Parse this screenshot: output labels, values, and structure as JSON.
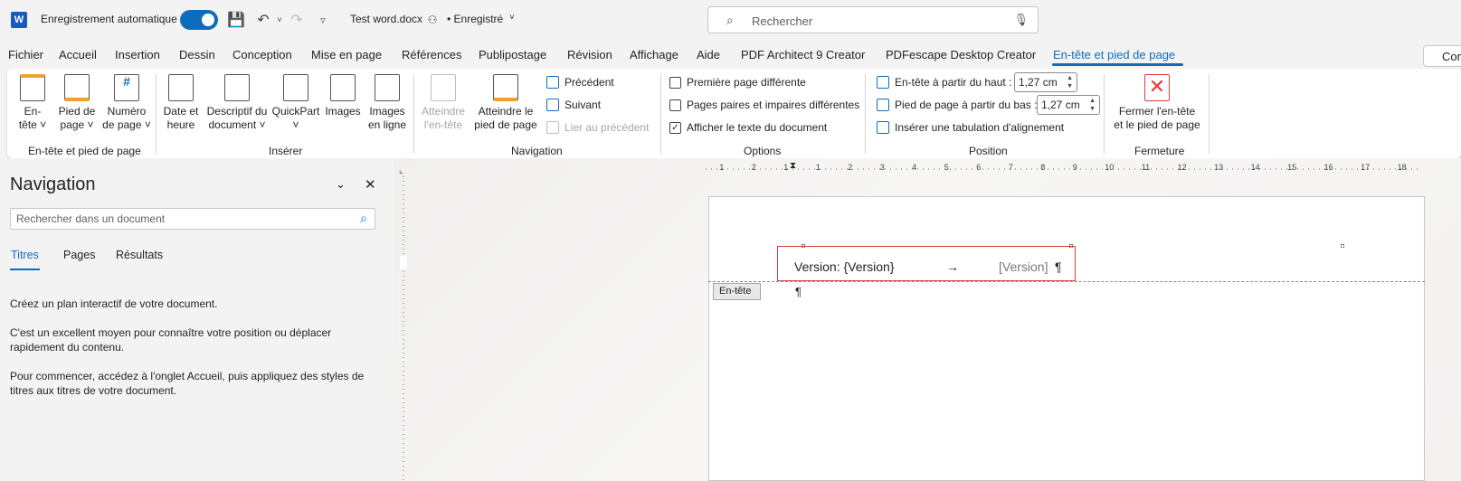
{
  "titlebar": {
    "app_logo": "W",
    "autosave_label": "Enregistrement automatique",
    "doc_title": "Test word.docx",
    "saved_label": "• Enregistré",
    "search_placeholder": "Rechercher"
  },
  "tabs": [
    "Fichier",
    "Accueil",
    "Insertion",
    "Dessin",
    "Conception",
    "Mise en page",
    "Références",
    "Publipostage",
    "Révision",
    "Affichage",
    "Aide",
    "PDF Architect 9 Creator",
    "PDFescape Desktop Creator",
    "En-tête et pied de page"
  ],
  "active_tab": "En-tête et pied de page",
  "comment_button": "Com",
  "ribbon": {
    "group1": {
      "label": "En-tête et pied de page",
      "btn_header": [
        "En-",
        "tête ˅"
      ],
      "btn_footer": [
        "Pied de",
        "page ˅"
      ],
      "btn_pagenum": [
        "Numéro",
        "de page ˅"
      ]
    },
    "group2": {
      "label": "Insérer",
      "btn_date": [
        "Date et",
        "heure"
      ],
      "btn_docinfo": [
        "Descriptif du",
        "document ˅"
      ],
      "btn_quickpart": [
        "QuickPart",
        "˅"
      ],
      "btn_images": [
        "Images",
        ""
      ],
      "btn_online": [
        "Images",
        "en ligne"
      ]
    },
    "group3": {
      "label": "Navigation",
      "btn_goto_header": [
        "Atteindre",
        "l'en-tête"
      ],
      "btn_goto_footer": [
        "Atteindre le",
        "pied de page"
      ],
      "previous": "Précédent",
      "next": "Suivant",
      "link_previous": "Lier au précédent"
    },
    "group4": {
      "label": "Options",
      "opt1": "Première page différente",
      "opt2": "Pages paires et impaires différentes",
      "opt3": "Afficher le texte du document",
      "opt3_checked": "✓"
    },
    "group5": {
      "label": "Position",
      "header_from_top": "En-tête à partir du haut :",
      "header_value": "1,27 cm",
      "footer_from_bottom": "Pied de page à partir du bas :",
      "footer_value": "1,27 cm",
      "insert_tab": "Insérer une tabulation d'alignement"
    },
    "group6": {
      "label": "Fermeture",
      "btn_close": [
        "Fermer l'en-tête",
        "et le pied de page"
      ]
    }
  },
  "nav": {
    "title": "Navigation",
    "search_placeholder": "Rechercher dans un document",
    "tabs": [
      "Titres",
      "Pages",
      "Résultats"
    ],
    "p1": "Créez un plan interactif de votre document.",
    "p2": "C'est un excellent moyen pour connaître votre position ou déplacer rapidement du contenu.",
    "p3": "Pour commencer, accédez à l'onglet Accueil, puis appliquez des styles de titres aux titres de votre document."
  },
  "ruler": [
    "1",
    "2",
    "1",
    "1",
    "2",
    "3",
    "4",
    "5",
    "6",
    "7",
    "8",
    "9",
    "10",
    "11",
    "12",
    "13",
    "14",
    "15",
    "16",
    "17",
    "18"
  ],
  "document": {
    "header_text_left": "Version: {Version}",
    "header_arrow": "→",
    "header_text_right": "[Version]",
    "pilcrow": "¶",
    "header_tag": "En-tête"
  },
  "colors": {
    "accent": "#0f6cbd",
    "header_border": "#e03c3c"
  }
}
